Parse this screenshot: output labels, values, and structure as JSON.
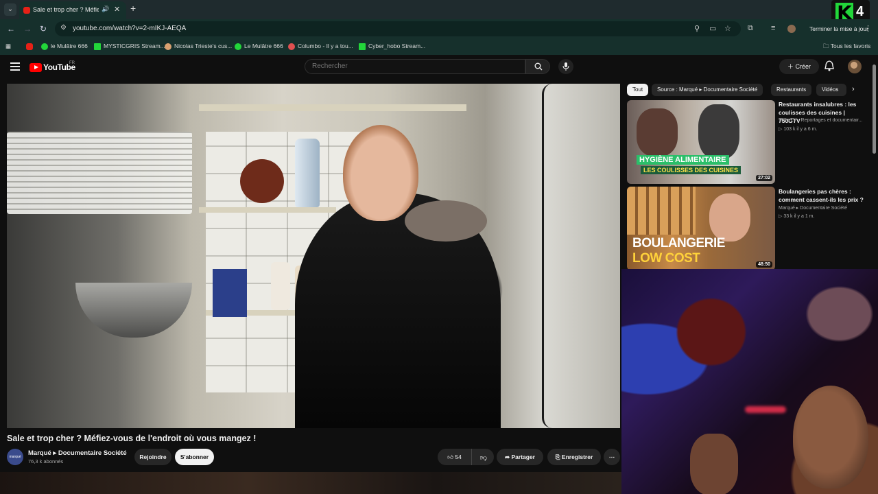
{
  "browser": {
    "tab_title": "Sale et trop cher ? Méfiez-v",
    "url": "youtube.com/watch?v=2-mIKJ-AEQA",
    "update_label": "Terminer la mise à jour",
    "all_bookmarks": "Tous les favoris",
    "overlay_logo": "4",
    "bookmarks": [
      {
        "label": "le Mulâtre 666",
        "color": "#22d63a"
      },
      {
        "label": "MYSTICGRIS Stream...",
        "color": "#22d63a"
      },
      {
        "label": "Nicolas Trieste's cus...",
        "color": "#d9a070"
      },
      {
        "label": "Le Mulâtre 666",
        "color": "#22d63a"
      },
      {
        "label": "Columbo - Il y a tou...",
        "color": "#e05050"
      },
      {
        "label": "Cyber_hobo Stream...",
        "color": "#22d63a"
      }
    ]
  },
  "youtube": {
    "logo_text": "YouTube",
    "country": "FR",
    "search_placeholder": "Rechercher",
    "create_label": "Créer",
    "video": {
      "title": "Sale et trop cher ? Méfiez-vous de l'endroit où vous mangez !",
      "channel": "Marqué ▸ Documentaire Société",
      "channel_avatar_text": "marqué",
      "subscribers": "76,3 k abonnés",
      "join_label": "Rejoindre",
      "subscribe_label": "S'abonner",
      "likes": "54",
      "share_label": "Partager",
      "save_label": "Enregistrer"
    },
    "chips": [
      "Tout",
      "Source : Marqué ▸ Documentaire Société",
      "Restaurants",
      "Vidéos"
    ],
    "recommendations": [
      {
        "title": "Restaurants insalubres : les coulisses des cuisines | 750GTV",
        "channel": "750g TV - Reportages et documentair...",
        "stats": "▷ 103 k   il y a 6 m.",
        "duration": "27:02",
        "thumb_line1": "HYGIÈNE ALIMENTAIRE",
        "thumb_line2": "LES COULISSES DES CUISINES"
      },
      {
        "title": "Boulangeries pas chères : comment cassent-ils les prix ?",
        "channel": "Marqué ▸ Documentaire Société",
        "stats": "▷ 33 k   il y a 1 m.",
        "duration": "48:50",
        "thumb_line1": "BOULANGERIE",
        "thumb_line2": "LOW COST"
      }
    ]
  }
}
